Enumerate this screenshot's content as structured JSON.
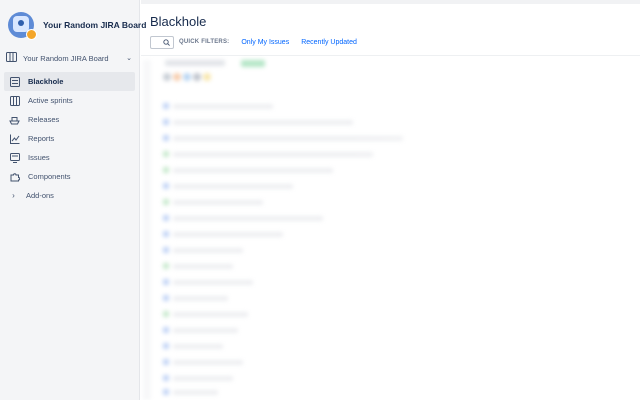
{
  "project": {
    "name": "Your Random JIRA Board"
  },
  "board_selector": {
    "label": "Your Random JIRA Board"
  },
  "nav": [
    {
      "label": "Blackhole",
      "icon": "backlog-icon",
      "active": true
    },
    {
      "label": "Active sprints",
      "icon": "board-icon",
      "active": false
    },
    {
      "label": "Releases",
      "icon": "ship-icon",
      "active": false
    },
    {
      "label": "Reports",
      "icon": "chart-icon",
      "active": false
    },
    {
      "label": "Issues",
      "icon": "issues-icon",
      "active": false
    },
    {
      "label": "Components",
      "icon": "puzzle-icon",
      "active": false
    },
    {
      "label": "Add-ons",
      "icon": "chevron-right-icon",
      "active": false
    }
  ],
  "page": {
    "title": "Blackhole"
  },
  "quick_filters": {
    "label": "QUICK FILTERS:",
    "items": [
      "Only My Issues",
      "Recently Updated"
    ]
  },
  "colors": {
    "accent": "#0065ff",
    "sidebar_bg": "#f4f5f7",
    "active_item_bg": "#e6e8ec",
    "avatar": "#5e8bd6",
    "badge": "#f4a62a"
  }
}
